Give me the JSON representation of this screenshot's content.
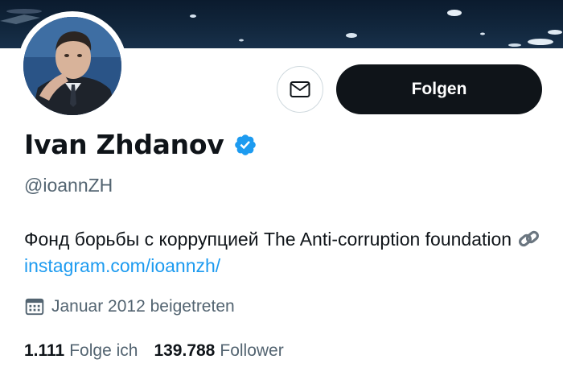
{
  "profile": {
    "name": "Ivan Zhdanov",
    "handle": "@ioannZH",
    "bio_text": "Фонд борьбы с коррупцией The Anti-corruption foundation ",
    "bio_link": "instagram.com/ioannzh/",
    "joined": "Januar 2012 beigetreten",
    "verified": true
  },
  "actions": {
    "follow_label": "Folgen",
    "message_icon": "envelope-icon"
  },
  "stats": {
    "following_count": "1.111",
    "following_label": "Folge ich",
    "followers_count": "139.788",
    "followers_label": "Follower"
  },
  "colors": {
    "accent": "#1d9bf0",
    "text": "#0f1419",
    "secondary": "#536471",
    "button_bg": "#0f1419"
  }
}
